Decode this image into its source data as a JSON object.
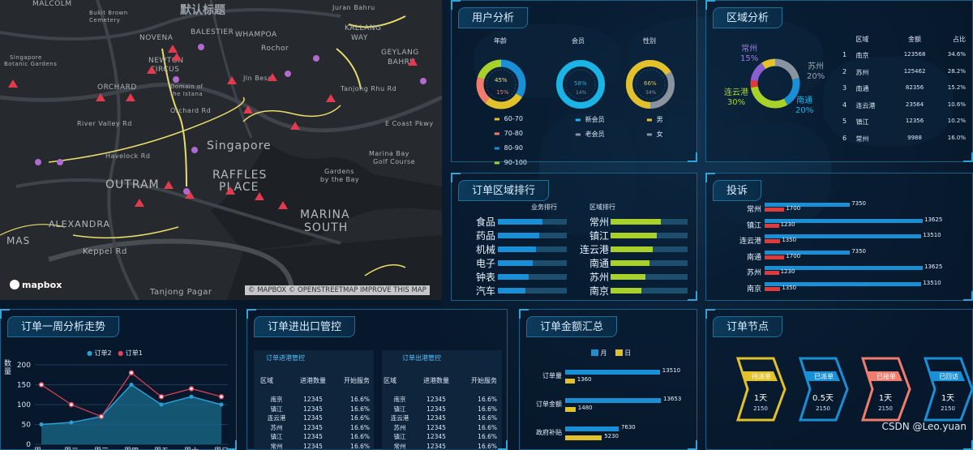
{
  "map": {
    "title": "默认标题",
    "labels": [
      "MALCOLM",
      "Bukit Brown",
      "Cemetery",
      "BALESTIER",
      "WHAMPOA",
      "KALLANG",
      "WAY",
      "GEYLANG",
      "BAHRU",
      "NOVENA",
      "Singapore",
      "Botanic Gardens",
      "NEWTON",
      "CIRCUS",
      "ORCHARD",
      "Domain of",
      "the Istana",
      "River Valley Rd",
      "Singapore",
      "RAFFLES",
      "PLACE",
      "OUTRAM",
      "MARINA",
      "SOUTH",
      "ALEXANDRA",
      "MAS",
      "Keppel Rd",
      "Tanjong Pagar",
      "E Coast Pkwy",
      "Marina Bay",
      "Golf Course",
      "Gardens",
      "by the Bay",
      "Rochor",
      "Juran Bahru",
      "Tanjong Rhu Rd",
      "Jln Besar",
      "Orchard Rd",
      "Havelock Rd"
    ],
    "logo": "mapbox",
    "attribution": "© MAPBOX © OPENSTREETMAP IMPROVE THIS MAP"
  },
  "user": {
    "title": "用户分析",
    "charts": [
      {
        "label": "年龄",
        "center_top": "45%",
        "center_bottom": "15%"
      },
      {
        "label": "会员",
        "center_top": "58%",
        "center_bottom": "14%"
      },
      {
        "label": "性别",
        "center_top": "66%",
        "center_bottom": "34%"
      }
    ],
    "age_legend": [
      "60-70",
      "70-80",
      "80-90",
      "90-100"
    ],
    "member_legend": [
      "新会员",
      "老会员"
    ],
    "gender_legend": [
      "男",
      "女"
    ]
  },
  "region": {
    "title": "区域分析",
    "donut_labels": [
      {
        "name": "常州",
        "pct": "15%"
      },
      {
        "name": "苏州",
        "pct": "20%"
      },
      {
        "name": "连云港",
        "pct": "30%"
      },
      {
        "name": "南通",
        "pct": "20%"
      }
    ],
    "table_headers": [
      "区域",
      "金额",
      "占比"
    ],
    "rows": [
      {
        "no": "1",
        "area": "南京",
        "amount": "123568",
        "share": "34.6%"
      },
      {
        "no": "2",
        "area": "苏州",
        "amount": "125462",
        "share": "28.2%"
      },
      {
        "no": "3",
        "area": "南通",
        "amount": "82356",
        "share": "15.2%"
      },
      {
        "no": "4",
        "area": "连云港",
        "amount": "23564",
        "share": "10.6%"
      },
      {
        "no": "5",
        "area": "镇江",
        "amount": "12356",
        "share": "10.2%"
      },
      {
        "no": "6",
        "area": "常州",
        "amount": "9988",
        "share": "16.0%"
      }
    ]
  },
  "ranking": {
    "title": "订单区域排行",
    "left_header": "业务排行",
    "right_header": "区域排行",
    "left": [
      {
        "label": "食品",
        "value": 0.65
      },
      {
        "label": "药品",
        "value": 0.6
      },
      {
        "label": "机械",
        "value": 0.55
      },
      {
        "label": "电子",
        "value": 0.5
      },
      {
        "label": "钟表",
        "value": 0.45
      },
      {
        "label": "汽车",
        "value": 0.4
      }
    ],
    "right": [
      {
        "label": "常州",
        "value": 0.65
      },
      {
        "label": "镇江",
        "value": 0.6
      },
      {
        "label": "连云港",
        "value": 0.55
      },
      {
        "label": "南通",
        "value": 0.5
      },
      {
        "label": "苏州",
        "value": 0.45
      },
      {
        "label": "南京",
        "value": 0.4
      }
    ]
  },
  "complaints": {
    "title": "投诉",
    "max": 13625,
    "rows": [
      {
        "label": "常州",
        "a": 7350,
        "b": 1700
      },
      {
        "label": "镇江",
        "a": 13625,
        "b": 1230
      },
      {
        "label": "连云港",
        "a": 13510,
        "b": 1350
      },
      {
        "label": "南通",
        "a": 7350,
        "b": 1700
      },
      {
        "label": "苏州",
        "a": 13625,
        "b": 1230
      },
      {
        "label": "南京",
        "a": 13510,
        "b": 1350
      }
    ]
  },
  "weekly": {
    "title": "订单一周分析走势",
    "ylabel": "数量",
    "legend": [
      "订单2",
      "订单1"
    ]
  },
  "chart_data": {
    "type": "line",
    "x": [
      "周一",
      "周二",
      "周三",
      "周四",
      "周五",
      "周六",
      "周日"
    ],
    "series": [
      {
        "name": "订单2",
        "values": [
          50,
          55,
          70,
          150,
          100,
          120,
          100
        ]
      },
      {
        "name": "订单1",
        "values": [
          150,
          100,
          70,
          180,
          120,
          140,
          120
        ]
      }
    ],
    "ylim": [
      0,
      200
    ],
    "yticks": [
      "200",
      "150",
      "100",
      "50",
      "0"
    ]
  },
  "io": {
    "title": "订单进出口管控",
    "import_title": "订单进港管控",
    "export_title": "订单出港管控",
    "headers": [
      "区域",
      "进港数量",
      "开始服务"
    ],
    "headers_out": [
      "区域",
      "进港数量",
      "开始服务"
    ],
    "rows": [
      {
        "area": "南京",
        "qty": "12345",
        "pct": "16.6%"
      },
      {
        "area": "镇江",
        "qty": "12345",
        "pct": "16.6%"
      },
      {
        "area": "连云港",
        "qty": "12345",
        "pct": "16.6%"
      },
      {
        "area": "苏州",
        "qty": "12345",
        "pct": "16.6%"
      },
      {
        "area": "镇江",
        "qty": "12345",
        "pct": "16.6%"
      },
      {
        "area": "常州",
        "qty": "12345",
        "pct": "16.6%"
      }
    ]
  },
  "amount": {
    "title": "订单金额汇总",
    "legend": [
      "月",
      "日"
    ],
    "max": 13653,
    "rows": [
      {
        "label": "订单量",
        "month": 13510,
        "day": 1360
      },
      {
        "label": "订单金额",
        "month": 13653,
        "day": 1480
      },
      {
        "label": "政府补贴",
        "month": 7630,
        "day": 5230
      }
    ]
  },
  "nodes": {
    "title": "订单节点",
    "items": [
      {
        "label": "待派单",
        "value": "1天",
        "sub": "2150",
        "color": "#e2c12a",
        "fill": true
      },
      {
        "label": "已派单",
        "value": "0.5天",
        "sub": "2150",
        "color": "#1a8fd6",
        "fill": false
      },
      {
        "label": "已接单",
        "value": "1天",
        "sub": "2150",
        "color": "#f07c6d",
        "fill": false
      },
      {
        "label": "已回访",
        "value": "1天",
        "sub": "2150",
        "color": "#1a8fd6",
        "fill": false
      }
    ]
  },
  "watermark": "CSDN @Leo.yuan",
  "colors": {
    "blue": "#1a8fd6",
    "lime": "#a8d22a",
    "red": "#e03b3b",
    "yellow": "#e2c12a"
  }
}
